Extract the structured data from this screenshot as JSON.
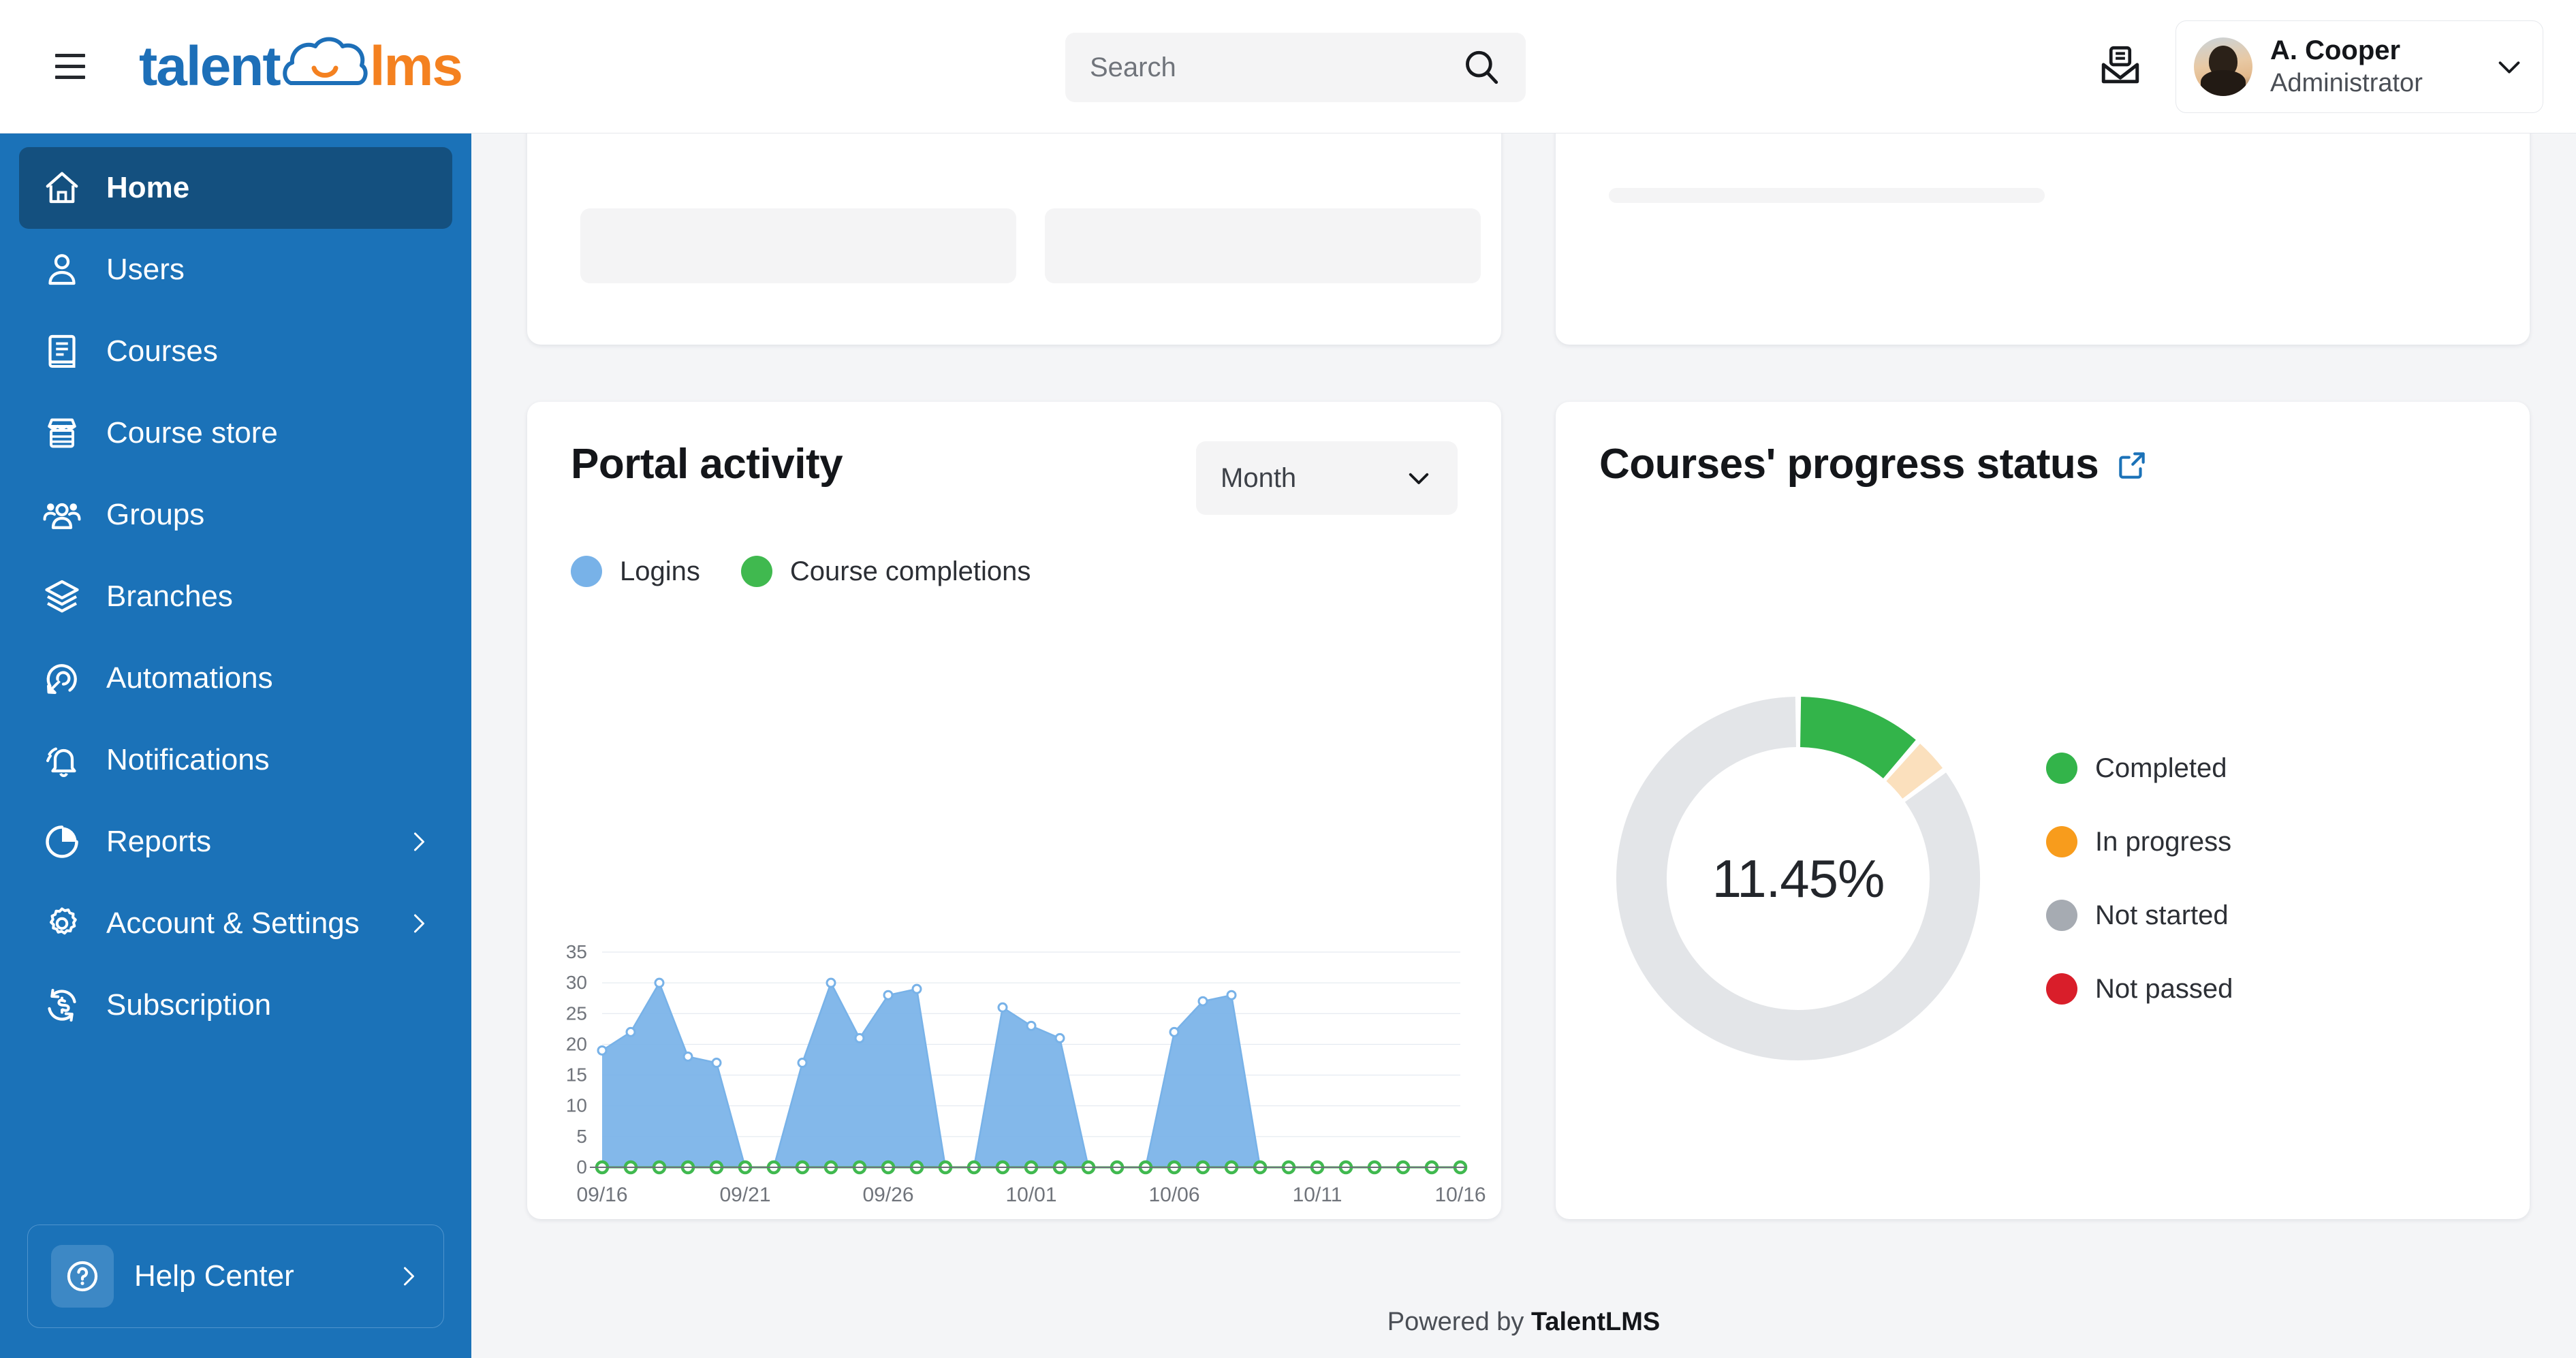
{
  "header": {
    "menu_icon": "hamburger-menu-icon",
    "logo": {
      "part1": "talent",
      "part2": "lms",
      "cloud_icon": "cloud-smile-icon"
    },
    "search": {
      "placeholder": "Search",
      "value": "",
      "icon": "search-icon"
    },
    "mail_icon": "inbox-mail-icon",
    "user": {
      "name": "A. Cooper",
      "role": "Administrator",
      "caret_icon": "chevron-down-icon",
      "avatar_icon": "user-avatar"
    }
  },
  "sidebar": {
    "items": [
      {
        "label": "Home",
        "icon": "home-icon",
        "active": true,
        "caret": false
      },
      {
        "label": "Users",
        "icon": "user-icon",
        "active": false,
        "caret": false
      },
      {
        "label": "Courses",
        "icon": "book-icon",
        "active": false,
        "caret": false
      },
      {
        "label": "Course store",
        "icon": "store-icon",
        "active": false,
        "caret": false
      },
      {
        "label": "Groups",
        "icon": "groups-icon",
        "active": false,
        "caret": false
      },
      {
        "label": "Branches",
        "icon": "layers-icon",
        "active": false,
        "caret": false
      },
      {
        "label": "Automations",
        "icon": "automation-icon",
        "active": false,
        "caret": false
      },
      {
        "label": "Notifications",
        "icon": "bell-icon",
        "active": false,
        "caret": false
      },
      {
        "label": "Reports",
        "icon": "pie-chart-icon",
        "active": false,
        "caret": true
      },
      {
        "label": "Account & Settings",
        "icon": "gear-icon",
        "active": false,
        "caret": true
      },
      {
        "label": "Subscription",
        "icon": "refresh-dollar-icon",
        "active": false,
        "caret": false
      }
    ],
    "help_center": {
      "label": "Help Center",
      "icon": "question-circle-icon",
      "caret_icon": "chevron-right-icon"
    }
  },
  "main": {
    "portal_activity": {
      "title": "Portal activity",
      "period": {
        "selected": "Month",
        "caret_icon": "chevron-down-icon"
      },
      "legend": [
        {
          "label": "Logins",
          "color": "#78b2e8"
        },
        {
          "label": "Course completions",
          "color": "#40b94f"
        }
      ]
    },
    "courses_progress": {
      "title": "Courses' progress status",
      "external_link_icon": "external-link-icon",
      "center_value": "11.45%",
      "legend": [
        {
          "label": "Completed",
          "color": "#33b44a"
        },
        {
          "label": "In progress",
          "color": "#f89c1c"
        },
        {
          "label": "Not started",
          "color": "#a6abb2"
        },
        {
          "label": "Not passed",
          "color": "#d91e2a"
        }
      ]
    }
  },
  "footer": {
    "prefix": "Powered by ",
    "brand": "TalentLMS"
  },
  "chart_data": [
    {
      "type": "area",
      "title": "Portal activity",
      "xlabel": "",
      "ylabel": "",
      "ylim": [
        0,
        35
      ],
      "yticks": [
        0,
        5,
        10,
        15,
        20,
        25,
        30,
        35
      ],
      "grid": true,
      "legend_position": "top",
      "x": [
        "09/16",
        "09/17",
        "09/18",
        "09/19",
        "09/20",
        "09/21",
        "09/22",
        "09/23",
        "09/24",
        "09/25",
        "09/26",
        "09/27",
        "09/28",
        "09/29",
        "09/30",
        "10/01",
        "10/02",
        "10/03",
        "10/04",
        "10/05",
        "10/06",
        "10/07",
        "10/08",
        "10/09",
        "10/10",
        "10/11",
        "10/12",
        "10/13",
        "10/14",
        "10/15",
        "10/16"
      ],
      "xtick_labels": [
        "09/16",
        "09/21",
        "09/26",
        "10/01",
        "10/06",
        "10/11",
        "10/16"
      ],
      "series": [
        {
          "name": "Logins",
          "color": "#78b2e8",
          "values": [
            19,
            22,
            30,
            18,
            17,
            0,
            0,
            17,
            30,
            21,
            28,
            29,
            0,
            0,
            26,
            23,
            21,
            0,
            0,
            0,
            22,
            27,
            28,
            0,
            0,
            0,
            0,
            0,
            0,
            0,
            0
          ]
        },
        {
          "name": "Course completions",
          "color": "#40b94f",
          "values": [
            0,
            0,
            0,
            0,
            0,
            0,
            0,
            0,
            0,
            0,
            0,
            0,
            0,
            0,
            0,
            0,
            0,
            0,
            0,
            0,
            0,
            0,
            0,
            0,
            0,
            0,
            0,
            0,
            0,
            0,
            0
          ]
        }
      ]
    },
    {
      "type": "pie",
      "title": "Courses' progress status",
      "center_label": "11.45%",
      "donut": true,
      "legend_position": "right",
      "labels": [
        "Completed",
        "In progress",
        "Not started",
        "Not passed"
      ],
      "values": [
        11.45,
        3.4,
        85.15,
        0
      ],
      "colors": [
        "#33b44a",
        "#fbe0bd",
        "#e3e5e8",
        "#d91e2a"
      ]
    }
  ]
}
